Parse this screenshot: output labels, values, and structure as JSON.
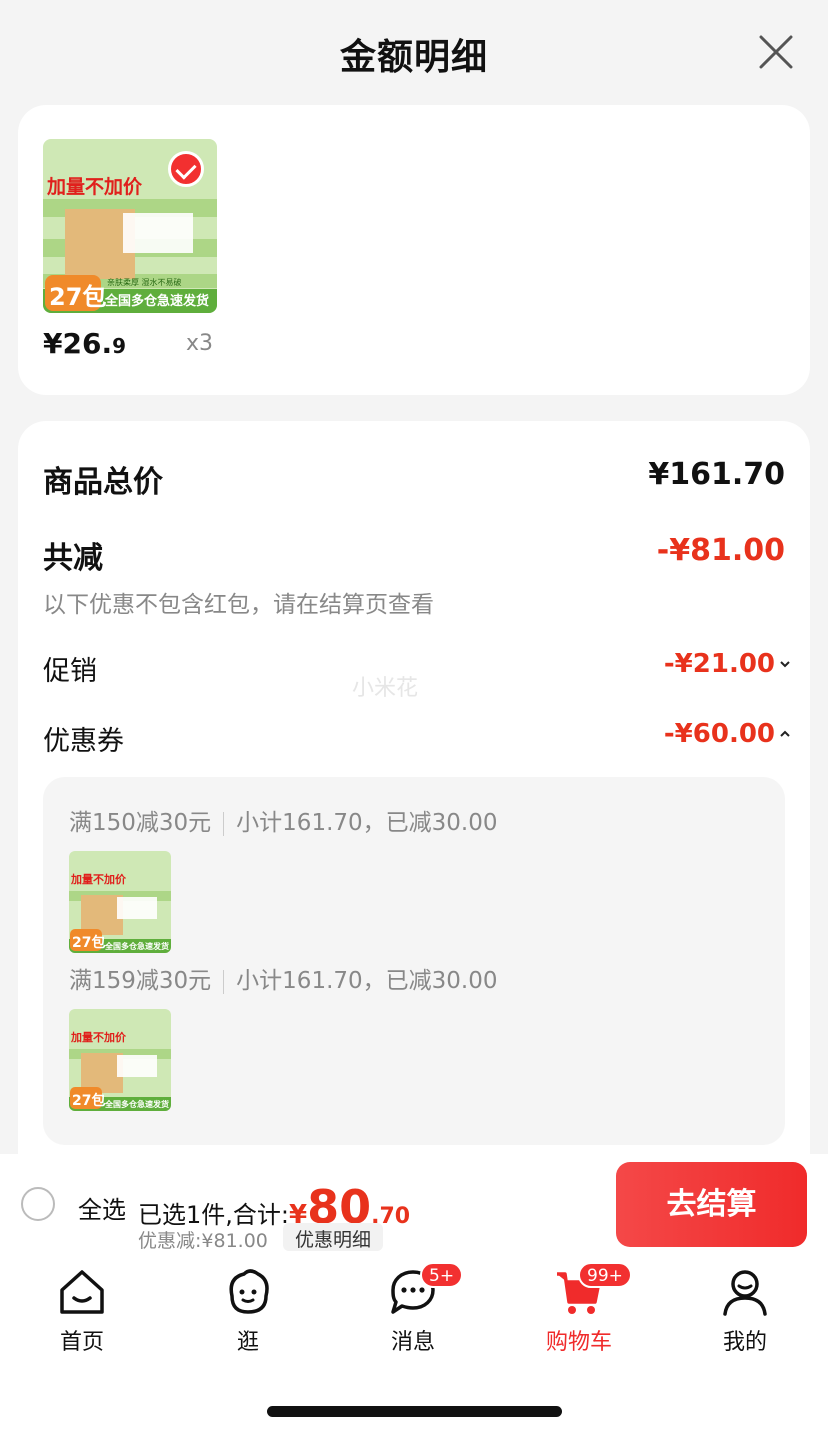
{
  "header": {
    "title": "金额明细"
  },
  "product": {
    "price_int": "¥26.",
    "price_dec": "9",
    "qty": "x3",
    "image_text": {
      "tagline": "加量不加价",
      "count": "27包",
      "strip": "全国多仓急速发货",
      "sub": "亲肤柔厚  湿水不易破"
    }
  },
  "detail": {
    "total_label": "商品总价",
    "total_amount": "¥161.70",
    "reduce_label": "共减",
    "reduce_amount": "-¥81.00",
    "note": "以下优惠不包含红包，请在结算页查看",
    "promo_label": "促销",
    "promo_amount": "-¥21.00",
    "coupon_label": "优惠券",
    "coupon_amount": "-¥60.00",
    "coupons": [
      {
        "rule": "满150减30元",
        "info": "小计161.70，已减30.00"
      },
      {
        "rule": "满159减30元",
        "info": "小计161.70，已减30.00"
      }
    ]
  },
  "watermark": "小米花",
  "checkout": {
    "select_all": "全选",
    "summary_prefix": "已选1件,合计:",
    "currency": "¥",
    "amount_int": "80",
    "amount_dec": ".70",
    "discount_text": "优惠减:¥81.00",
    "detail_chip": "优惠明细",
    "button": "去结算"
  },
  "tabs": [
    {
      "label": "首页",
      "icon": "home-icon"
    },
    {
      "label": "逛",
      "icon": "face-icon"
    },
    {
      "label": "消息",
      "icon": "chat-icon",
      "badge": "5+"
    },
    {
      "label": "购物车",
      "icon": "cart-icon",
      "badge": "99+",
      "active": true
    },
    {
      "label": "我的",
      "icon": "user-icon"
    }
  ],
  "colors": {
    "accent": "#f02b2b",
    "price_red": "#e8321c",
    "background": "#f4f4f4"
  }
}
